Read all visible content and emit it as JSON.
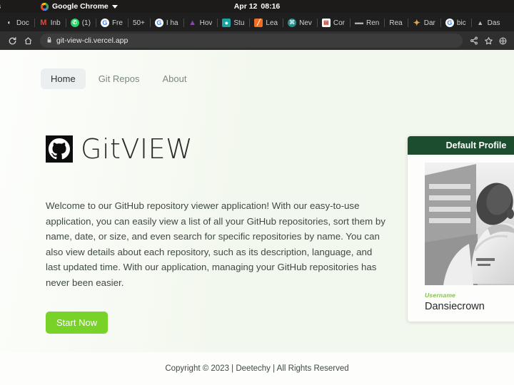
{
  "os_bar": {
    "left_partial": "s",
    "app_name": "Google Chrome",
    "app_icon": "chrome-icon",
    "menu_caret": "chevron-down-icon",
    "clock_date": "Apr 12",
    "clock_time": "08:16"
  },
  "browser": {
    "tabs": [
      {
        "label": "Doc",
        "icon": "docs-icon",
        "icon_class": "fi-docs",
        "glyph": "◐"
      },
      {
        "label": "Inb",
        "icon": "gmail-icon",
        "icon_class": "fi-gmail",
        "glyph": "M"
      },
      {
        "label": "(1)",
        "icon": "whatsapp-icon",
        "icon_class": "fi-wa",
        "glyph": "✆"
      },
      {
        "label": "Fre",
        "icon": "google-icon",
        "icon_class": "fi-g",
        "glyph": "G"
      },
      {
        "label": "50+",
        "icon": "no-icon",
        "icon_class": "fi-none",
        "glyph": ""
      },
      {
        "label": "I ha",
        "icon": "google-icon",
        "icon_class": "fi-g",
        "glyph": "G"
      },
      {
        "label": "Hov",
        "icon": "mountain-icon",
        "icon_class": "fi-mtn",
        "glyph": "▲"
      },
      {
        "label": "Stu",
        "icon": "location-pin-icon",
        "icon_class": "fi-pin",
        "glyph": "●"
      },
      {
        "label": "Lea",
        "icon": "orange-square-icon",
        "icon_class": "fi-orange",
        "glyph": "╱"
      },
      {
        "label": "Nev",
        "icon": "globe-icon",
        "icon_class": "fi-globe",
        "glyph": "⌘"
      },
      {
        "label": "Cor",
        "icon": "red-card-icon",
        "icon_class": "fi-red",
        "glyph": "▤"
      },
      {
        "label": "Ren",
        "icon": "grey-icon",
        "icon_class": "fi-grey",
        "glyph": "▬▬"
      },
      {
        "label": "Rea",
        "icon": "no-icon",
        "icon_class": "fi-none",
        "glyph": ""
      },
      {
        "label": "Dar",
        "icon": "star-icon",
        "icon_class": "fi-star",
        "glyph": "✦"
      },
      {
        "label": "bic",
        "icon": "google-icon",
        "icon_class": "fi-g",
        "glyph": "G"
      },
      {
        "label": "Das",
        "icon": "vercel-triangle-icon",
        "icon_class": "fi-tri",
        "glyph": "▲"
      }
    ],
    "reload_icon": "reload-icon",
    "home_icon": "home-icon",
    "lock_icon": "lock-icon",
    "url": "git-view-cli.vercel.app",
    "share_icon": "share-icon",
    "bookmark_icon": "star-outline-icon",
    "extensions_icon": "extensions-icon"
  },
  "site": {
    "nav": [
      {
        "label": "Home",
        "active": true
      },
      {
        "label": "Git Repos",
        "active": false
      },
      {
        "label": "About",
        "active": false
      }
    ],
    "logo": {
      "mark": "github-icon",
      "text": "GitVIEW"
    },
    "intro": "Welcome to our GitHub repository viewer application! With our easy-to-use application, you can easily view a list of all your GitHub repositories, sort them by name, date, or size, and even search for specific repositories by name. You can also view details about each repository, such as its description, language, and last updated time. With our application, managing your GitHub repositories has never been easier.",
    "cta_label": "Start Now",
    "profile_card": {
      "header": "Default Profile",
      "avatar_alt": "profile-photo",
      "username_label": "Username",
      "username_value": "Dansiecrown"
    },
    "footer_text": "Copyright © 2023 | Deetechy | All Rights Reserved",
    "colors": {
      "accent_green": "#79d227",
      "card_header_green": "#1b4d2e",
      "label_green": "#86c150",
      "page_bg": "#f3f8ee"
    }
  }
}
